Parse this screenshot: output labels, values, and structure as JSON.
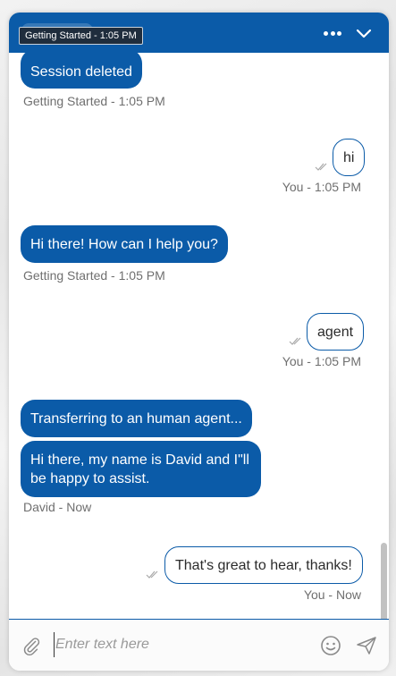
{
  "header": {
    "tooltip": "Getting Started - 1:05 PM",
    "more_icon": "more-horizontal-icon",
    "collapse_icon": "chevron-down-icon"
  },
  "colors": {
    "brand": "#0b5ba8",
    "meta_text": "#6f6f6f"
  },
  "messages": [
    {
      "direction": "in",
      "text": "Session deleted",
      "meta": "Getting Started - 1:05 PM"
    },
    {
      "direction": "out",
      "text": "hi",
      "meta": "You - 1:05 PM"
    },
    {
      "direction": "in",
      "text": "Hi there! How can I help you?",
      "meta": "Getting Started - 1:05 PM"
    },
    {
      "direction": "out",
      "text": "agent",
      "meta": "You - 1:05 PM"
    },
    {
      "direction": "in",
      "text": "Transferring to an human agent..."
    },
    {
      "direction": "in",
      "text": "Hi there, my name is David and I\"ll be happy to assist.",
      "meta": "David - Now"
    },
    {
      "direction": "out",
      "text": "That's great to hear, thanks!",
      "meta": "You - Now"
    }
  ],
  "composer": {
    "placeholder": "Enter text here",
    "attach_icon": "paperclip-icon",
    "emoji_icon": "smiley-icon",
    "send_icon": "send-icon"
  }
}
